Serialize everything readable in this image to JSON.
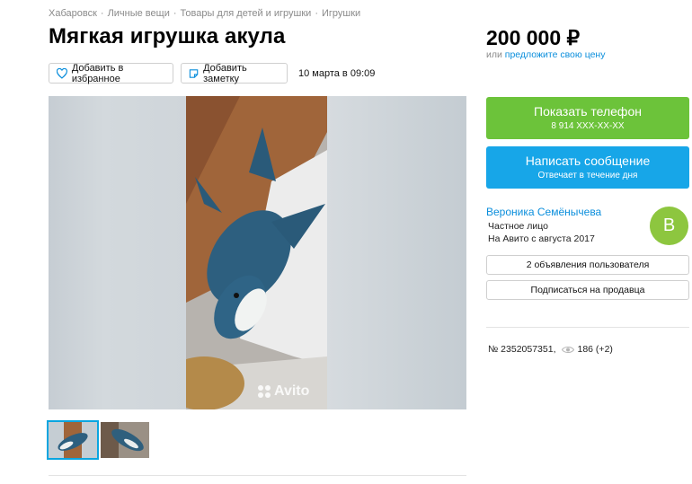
{
  "breadcrumb": [
    "Хабаровск",
    "Личные вещи",
    "Товары для детей и игрушки",
    "Игрушки"
  ],
  "title": "Мягкая игрушка акула",
  "actions": {
    "favorite_label": "Добавить в избранное",
    "note_label": "Добавить заметку",
    "date": "10 марта в 09:09"
  },
  "gallery": {
    "watermark": "Avito",
    "thumbnail_count": 2
  },
  "price": {
    "value": "200 000 ₽",
    "alt_prefix": "или",
    "alt_link": "предложите свою цену"
  },
  "phone_button": {
    "label": "Показать телефон",
    "number": "8 914 XXX-XX-XX"
  },
  "message_button": {
    "label": "Написать сообщение",
    "sub": "Отвечает в течение дня"
  },
  "seller": {
    "name": "Вероника Семёнычева",
    "type": "Частное лицо",
    "since": "На Авито с августа 2017",
    "avatar_letter": "В"
  },
  "seller_actions": {
    "ads_label": "2 объявления пользователя",
    "subscribe_label": "Подписаться на продавца"
  },
  "stats": {
    "ad_number": "№ 2352057351,",
    "views": "186 (+2)"
  },
  "colors": {
    "phone_button": "#6cc33a",
    "message_button": "#17a6e8",
    "link": "#0a8edc",
    "avatar": "#8dc63f"
  }
}
